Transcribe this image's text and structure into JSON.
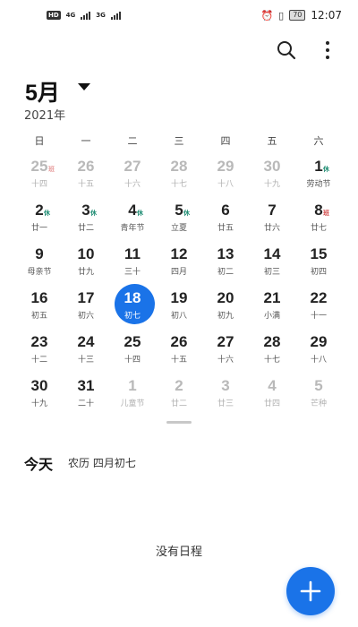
{
  "status_bar": {
    "left": {
      "hd": "HD",
      "net1": "4G",
      "net2": "3G"
    },
    "battery": "70",
    "time": "12:07",
    "icons": [
      "alarm-icon",
      "vibrate-icon",
      "battery-icon"
    ]
  },
  "toolbar": {
    "search_icon": "search-icon",
    "menu_icon": "more-vertical-icon"
  },
  "header": {
    "month": "5月",
    "year": "2021年"
  },
  "weekdays": [
    "日",
    "一",
    "二",
    "三",
    "四",
    "五",
    "六"
  ],
  "weeks": [
    [
      {
        "day": "25",
        "lunar": "十四",
        "faded": true,
        "badge": "班"
      },
      {
        "day": "26",
        "lunar": "十五",
        "faded": true
      },
      {
        "day": "27",
        "lunar": "十六",
        "faded": true
      },
      {
        "day": "28",
        "lunar": "十七",
        "faded": true
      },
      {
        "day": "29",
        "lunar": "十八",
        "faded": true
      },
      {
        "day": "30",
        "lunar": "十九",
        "faded": true
      },
      {
        "day": "1",
        "lunar": "劳动节",
        "badge": "休"
      }
    ],
    [
      {
        "day": "2",
        "lunar": "廿一",
        "badge": "休"
      },
      {
        "day": "3",
        "lunar": "廿二",
        "badge": "休"
      },
      {
        "day": "4",
        "lunar": "青年节",
        "badge": "休"
      },
      {
        "day": "5",
        "lunar": "立夏",
        "badge": "休"
      },
      {
        "day": "6",
        "lunar": "廿五"
      },
      {
        "day": "7",
        "lunar": "廿六"
      },
      {
        "day": "8",
        "lunar": "廿七",
        "badge": "班"
      }
    ],
    [
      {
        "day": "9",
        "lunar": "母亲节"
      },
      {
        "day": "10",
        "lunar": "廿九"
      },
      {
        "day": "11",
        "lunar": "三十"
      },
      {
        "day": "12",
        "lunar": "四月"
      },
      {
        "day": "13",
        "lunar": "初二"
      },
      {
        "day": "14",
        "lunar": "初三"
      },
      {
        "day": "15",
        "lunar": "初四"
      }
    ],
    [
      {
        "day": "16",
        "lunar": "初五"
      },
      {
        "day": "17",
        "lunar": "初六"
      },
      {
        "day": "18",
        "lunar": "初七",
        "selected": true
      },
      {
        "day": "19",
        "lunar": "初八"
      },
      {
        "day": "20",
        "lunar": "初九"
      },
      {
        "day": "21",
        "lunar": "小满"
      },
      {
        "day": "22",
        "lunar": "十一"
      }
    ],
    [
      {
        "day": "23",
        "lunar": "十二"
      },
      {
        "day": "24",
        "lunar": "十三"
      },
      {
        "day": "25",
        "lunar": "十四"
      },
      {
        "day": "26",
        "lunar": "十五"
      },
      {
        "day": "27",
        "lunar": "十六"
      },
      {
        "day": "28",
        "lunar": "十七"
      },
      {
        "day": "29",
        "lunar": "十八"
      }
    ],
    [
      {
        "day": "30",
        "lunar": "十九"
      },
      {
        "day": "31",
        "lunar": "二十"
      },
      {
        "day": "1",
        "lunar": "儿童节",
        "faded": true
      },
      {
        "day": "2",
        "lunar": "廿二",
        "faded": true
      },
      {
        "day": "3",
        "lunar": "廿三",
        "faded": true
      },
      {
        "day": "4",
        "lunar": "廿四",
        "faded": true
      },
      {
        "day": "5",
        "lunar": "芒种",
        "faded": true
      }
    ]
  ],
  "today": {
    "label": "今天",
    "lunar": "农历 四月初七"
  },
  "schedule": {
    "empty_text": "没有日程"
  },
  "fab": {
    "icon": "plus-icon"
  },
  "colors": {
    "accent": "#1a73e8",
    "rest_badge": "#1a8a70",
    "work_badge": "#d24b4b",
    "faded": "#b9b9b9"
  }
}
